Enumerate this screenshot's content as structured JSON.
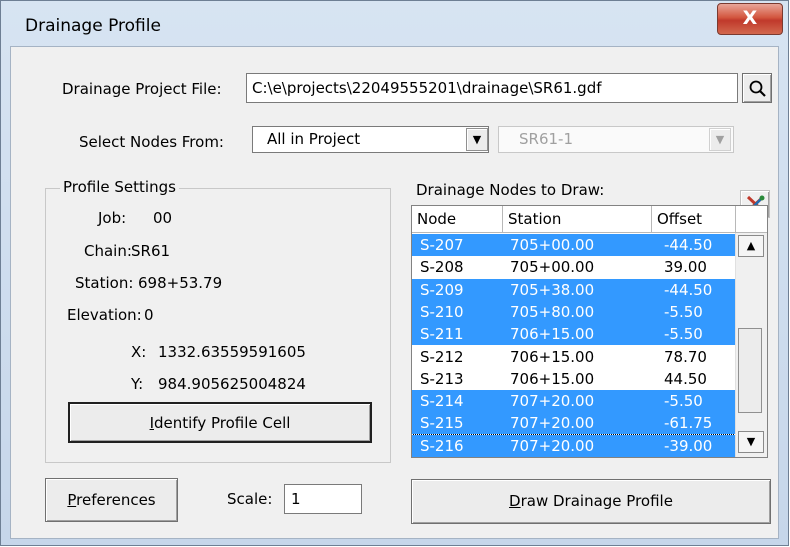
{
  "window": {
    "title": "Drainage Profile",
    "close_label": "X"
  },
  "project_file": {
    "label": "Drainage Project File:",
    "value": "C:\\e\\projects\\22049555201\\drainage\\SR61.gdf"
  },
  "select_nodes": {
    "label": "Select Nodes From:",
    "selected": "All in Project",
    "secondary": "SR61-1"
  },
  "profile_settings": {
    "title": "Profile Settings",
    "job_label": "Job:",
    "job": "00",
    "chain_label": "Chain:",
    "chain": "SR61",
    "station_label": "Station:",
    "station": "698+53.79",
    "elevation_label": "Elevation:",
    "elevation": "0",
    "x_label": "X:",
    "x": "1332.63559591605",
    "y_label": "Y:",
    "y": "984.905625004824",
    "identify_ul": "I",
    "identify_rest": "dentify Profile Cell"
  },
  "nodes_list": {
    "title": "Drainage Nodes to Draw:",
    "columns": [
      "Node",
      "Station",
      "Offset"
    ],
    "rows": [
      {
        "node": "S-207",
        "station": "705+00.00",
        "offset": "-44.50",
        "selected": true
      },
      {
        "node": "S-208",
        "station": "705+00.00",
        "offset": "39.00",
        "selected": false
      },
      {
        "node": "S-209",
        "station": "705+38.00",
        "offset": "-44.50",
        "selected": true
      },
      {
        "node": "S-210",
        "station": "705+80.00",
        "offset": "-5.50",
        "selected": true
      },
      {
        "node": "S-211",
        "station": "706+15.00",
        "offset": "-5.50",
        "selected": true
      },
      {
        "node": "S-212",
        "station": "706+15.00",
        "offset": "78.70",
        "selected": false
      },
      {
        "node": "S-213",
        "station": "706+15.00",
        "offset": "44.50",
        "selected": false
      },
      {
        "node": "S-214",
        "station": "707+20.00",
        "offset": "-5.50",
        "selected": true
      },
      {
        "node": "S-215",
        "station": "707+20.00",
        "offset": "-61.75",
        "selected": true
      },
      {
        "node": "S-216",
        "station": "707+20.00",
        "offset": "-39.00",
        "selected": true
      }
    ]
  },
  "footer": {
    "preferences_ul": "P",
    "preferences_rest": "references",
    "scale_label": "Scale:",
    "scale_value": "1",
    "draw_ul": "D",
    "draw_rest": "raw Drainage Profile"
  },
  "colors": {
    "selection": "#3399ff",
    "close": "#c7402b"
  },
  "icons": {
    "search": "search-icon",
    "clear_selection": "clear-selection-icon",
    "dropdown": "chevron-down-icon"
  }
}
